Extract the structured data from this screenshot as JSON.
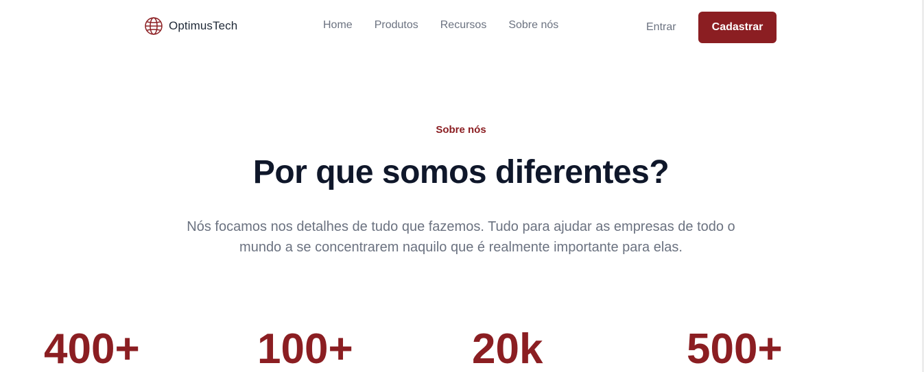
{
  "header": {
    "logo_text": "OptimusTech",
    "logo_icon": "globe-icon",
    "nav": [
      "Home",
      "Produtos",
      "Recursos",
      "Sobre nós"
    ],
    "login_label": "Entrar",
    "signup_label": "Cadastrar"
  },
  "hero": {
    "eyebrow": "Sobre nós",
    "title": "Por que somos diferentes?",
    "description": "Nós focamos nos detalhes de tudo que fazemos. Tudo para ajudar as empresas de todo o mundo a se concentrarem naquilo que é realmente importante para elas."
  },
  "stats": [
    "400+",
    "100+",
    "20k",
    "500+"
  ],
  "colors": {
    "accent": "#8b1e22",
    "heading": "#0f172a",
    "muted": "#6b7280"
  }
}
